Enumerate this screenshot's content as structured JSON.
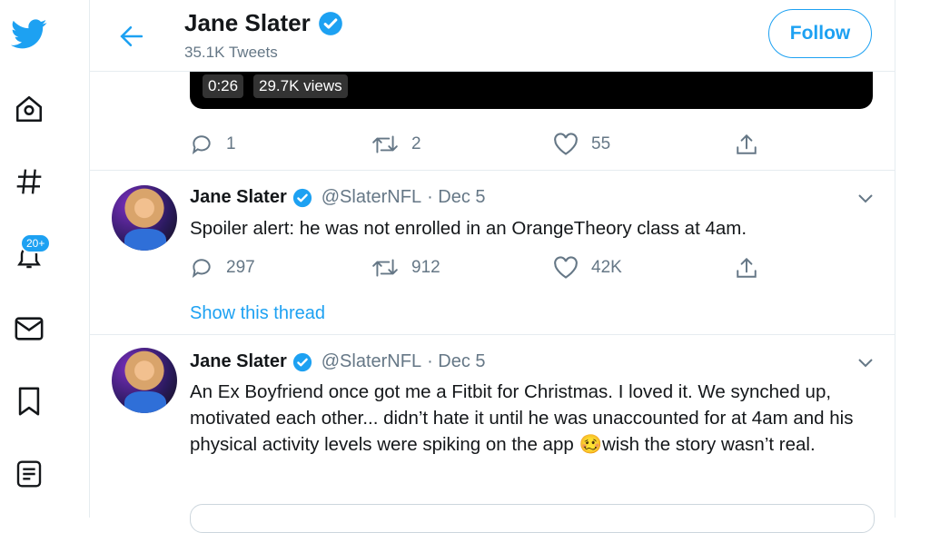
{
  "header": {
    "name": "Jane Slater",
    "tweet_count": "35.1K Tweets",
    "follow_label": "Follow"
  },
  "sidebar": {
    "notifications_badge": "20+"
  },
  "video": {
    "duration": "0:26",
    "views": "29.7K views"
  },
  "first_actions": {
    "replies": "1",
    "retweets": "2",
    "likes": "55"
  },
  "tweets": [
    {
      "name": "Jane Slater",
      "handle": "@SlaterNFL",
      "date": "· Dec 5",
      "text": "Spoiler alert: he was not enrolled in an OrangeTheory class at 4am.",
      "replies": "297",
      "retweets": "912",
      "likes": "42K",
      "thread_link": "Show this thread"
    },
    {
      "name": "Jane Slater",
      "handle": "@SlaterNFL",
      "date": "· Dec 5",
      "text": "An Ex Boyfriend once got me a Fitbit for Christmas. I loved it. We synched up, motivated each other... didn’t hate it until he was unaccounted for at 4am and his physical activity levels were spiking on the app 🥴wish the story wasn’t real."
    }
  ],
  "colors": {
    "brand": "#1da1f2",
    "muted": "#657786",
    "border": "#e6ecf0"
  }
}
